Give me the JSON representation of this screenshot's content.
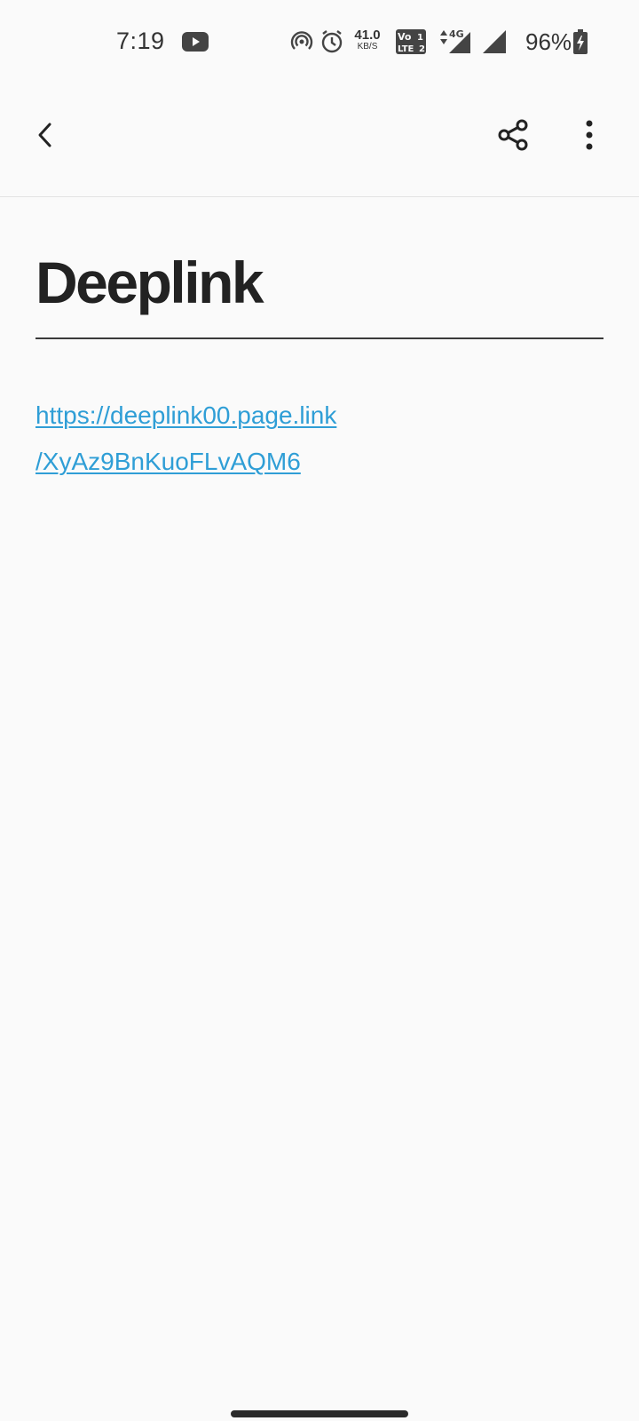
{
  "status_bar": {
    "time": "7:19",
    "net_speed_value": "41.0",
    "net_speed_unit": "KB/S",
    "network_type": "4G",
    "battery_percent": "96%",
    "icons": [
      "youtube-icon",
      "hotspot-icon",
      "alarm-icon",
      "volte-icon",
      "signal-icon",
      "signal-icon",
      "battery-charging-icon"
    ]
  },
  "toolbar": {
    "icons": [
      "back-icon",
      "share-icon",
      "more-vert-icon"
    ]
  },
  "note": {
    "title": "Deeplink",
    "link_line_1": "https://deeplink00.page.link",
    "link_line_2": "/XyAz9BnKuoFLvAQM6"
  },
  "colors": {
    "background": "#fafafa",
    "title": "#222222",
    "link": "#2f9ed6",
    "divider": "#3a3a3a"
  }
}
